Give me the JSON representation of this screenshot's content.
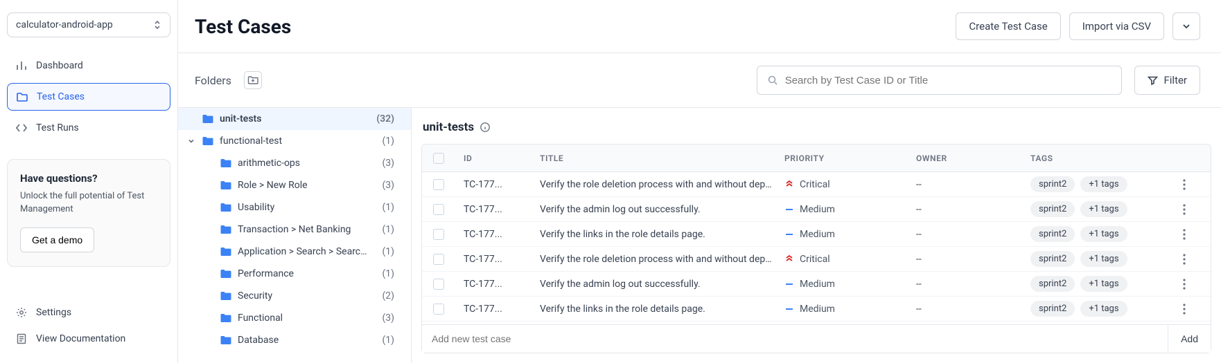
{
  "project_select": {
    "value": "calculator-android-app"
  },
  "nav": {
    "items": [
      {
        "label": "Dashboard",
        "icon": "bar-chart-icon",
        "active": false
      },
      {
        "label": "Test Cases",
        "icon": "folder-icon",
        "active": true
      },
      {
        "label": "Test Runs",
        "icon": "code-icon",
        "active": false
      }
    ]
  },
  "promo": {
    "heading": "Have questions?",
    "body": "Unlock the full potential of Test Management",
    "cta": "Get a demo"
  },
  "footer": {
    "settings_label": "Settings",
    "doc_label": "View Documentation"
  },
  "header": {
    "title": "Test Cases",
    "create_btn": "Create Test Case",
    "import_btn": "Import via CSV"
  },
  "toolbar": {
    "folders_label": "Folders",
    "search_placeholder": "Search by Test Case ID or Title",
    "filter_label": "Filter"
  },
  "folders": [
    {
      "name": "unit-tests",
      "count": "(32)",
      "depth": 0,
      "expandable": false,
      "selected": true
    },
    {
      "name": "functional-test",
      "count": "(1)",
      "depth": 0,
      "expandable": true,
      "expanded": true
    },
    {
      "name": "arithmetic-ops",
      "count": "(3)",
      "depth": 1
    },
    {
      "name": "Role > New Role",
      "count": "(3)",
      "depth": 1
    },
    {
      "name": "Usability",
      "count": "(1)",
      "depth": 1
    },
    {
      "name": "Transaction > Net Banking",
      "count": "(1)",
      "depth": 1
    },
    {
      "name": "Application > Search > Search fu...",
      "count": "(1)",
      "depth": 1
    },
    {
      "name": "Performance",
      "count": "(1)",
      "depth": 1
    },
    {
      "name": "Security",
      "count": "(2)",
      "depth": 1
    },
    {
      "name": "Functional",
      "count": "(3)",
      "depth": 1
    },
    {
      "name": "Database",
      "count": "(1)",
      "depth": 1
    }
  ],
  "table": {
    "current_folder": "unit-tests",
    "columns": {
      "id": "ID",
      "title": "TITLE",
      "priority": "PRIORITY",
      "owner": "OWNER",
      "tags": "TAGS"
    },
    "rows": [
      {
        "id": "TC-177...",
        "title": "Verify the role deletion process with and without dependen...",
        "priority": "Critical",
        "owner": "--",
        "tag1": "sprint2",
        "tag_more": "+1 tags"
      },
      {
        "id": "TC-177...",
        "title": "Verify the admin log out successfully.",
        "priority": "Medium",
        "owner": "--",
        "tag1": "sprint2",
        "tag_more": "+1 tags"
      },
      {
        "id": "TC-177...",
        "title": "Verify the links in the role details page.",
        "priority": "Medium",
        "owner": "--",
        "tag1": "sprint2",
        "tag_more": "+1 tags"
      },
      {
        "id": "TC-177...",
        "title": "Verify the role deletion process with and without dependen...",
        "priority": "Critical",
        "owner": "--",
        "tag1": "sprint2",
        "tag_more": "+1 tags"
      },
      {
        "id": "TC-177...",
        "title": "Verify the admin log out successfully.",
        "priority": "Medium",
        "owner": "--",
        "tag1": "sprint2",
        "tag_more": "+1 tags"
      },
      {
        "id": "TC-177...",
        "title": "Verify the links in the role details page.",
        "priority": "Medium",
        "owner": "--",
        "tag1": "sprint2",
        "tag_more": "+1 tags"
      }
    ],
    "add_placeholder": "Add new test case",
    "add_btn": "Add"
  },
  "colors": {
    "accent": "#2563eb",
    "folder_blue": "#3b82f6",
    "critical": "#dc2626"
  }
}
